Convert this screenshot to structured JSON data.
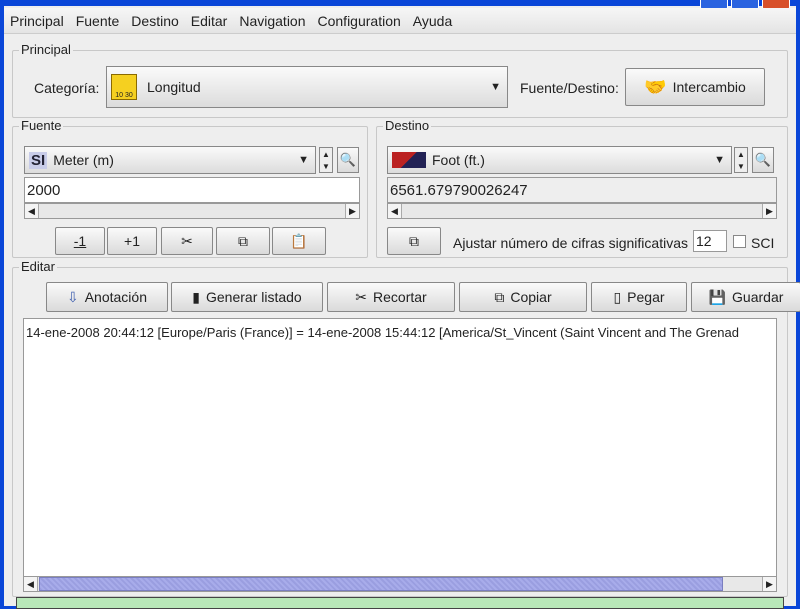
{
  "menu": [
    "Principal",
    "Fuente",
    "Destino",
    "Editar",
    "Navigation",
    "Configuration",
    "Ayuda"
  ],
  "principal": {
    "title": "Principal",
    "category_label": "Categoría:",
    "category_value": "Longitud",
    "swap_label": "Fuente/Destino:",
    "swap_button": "Intercambio"
  },
  "fuente": {
    "title": "Fuente",
    "unit": "Meter (m)",
    "value": "2000",
    "buttons": [
      "-1",
      "+1"
    ]
  },
  "destino": {
    "title": "Destino",
    "unit": "Foot (ft.)",
    "value": "6561.679790026247",
    "sig_label": "Ajustar número de cifras significativas",
    "sig_value": "12",
    "sci_label": "SCI",
    "sci_checked": false
  },
  "editar": {
    "title": "Editar",
    "buttons": [
      "Anotación",
      "Generar listado",
      "Recortar",
      "Copiar",
      "Pegar",
      "Guardar"
    ],
    "log": "14-ene-2008 20:44:12 [Europe/Paris (France)] = 14-ene-2008 15:44:12 [America/St_Vincent (Saint Vincent and The Grenad"
  },
  "colors": {
    "accent": "#0a46d8",
    "scroll_thumb": "#9a9ee0",
    "status": "#b8e8b8"
  }
}
